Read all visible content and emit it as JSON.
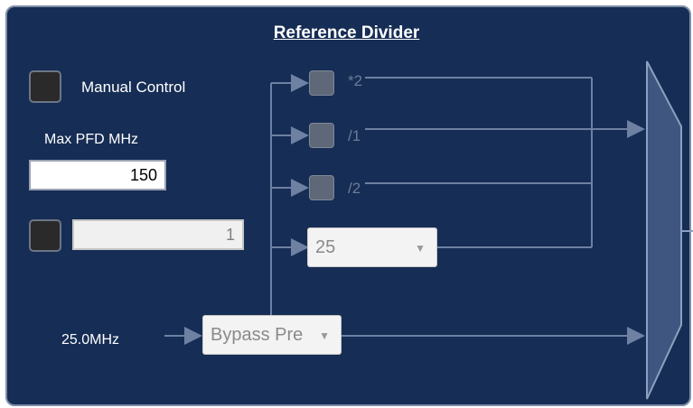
{
  "panel": {
    "title": "Reference Divider"
  },
  "manual_control": {
    "label": "Manual Control"
  },
  "max_pfd": {
    "label": "Max PFD MHz",
    "value": "150"
  },
  "divider_field": {
    "value": "1"
  },
  "input_freq": {
    "label": "25.0MHz"
  },
  "options": {
    "x2": "*2",
    "d1": "/1",
    "d2": "/2"
  },
  "divider_dropdown": {
    "selected": "25"
  },
  "bypass_dropdown": {
    "selected": "Bypass Pre"
  },
  "colors": {
    "panel_bg": "#162d55",
    "wire": "#6e81a3",
    "mux": "#3e5680"
  }
}
